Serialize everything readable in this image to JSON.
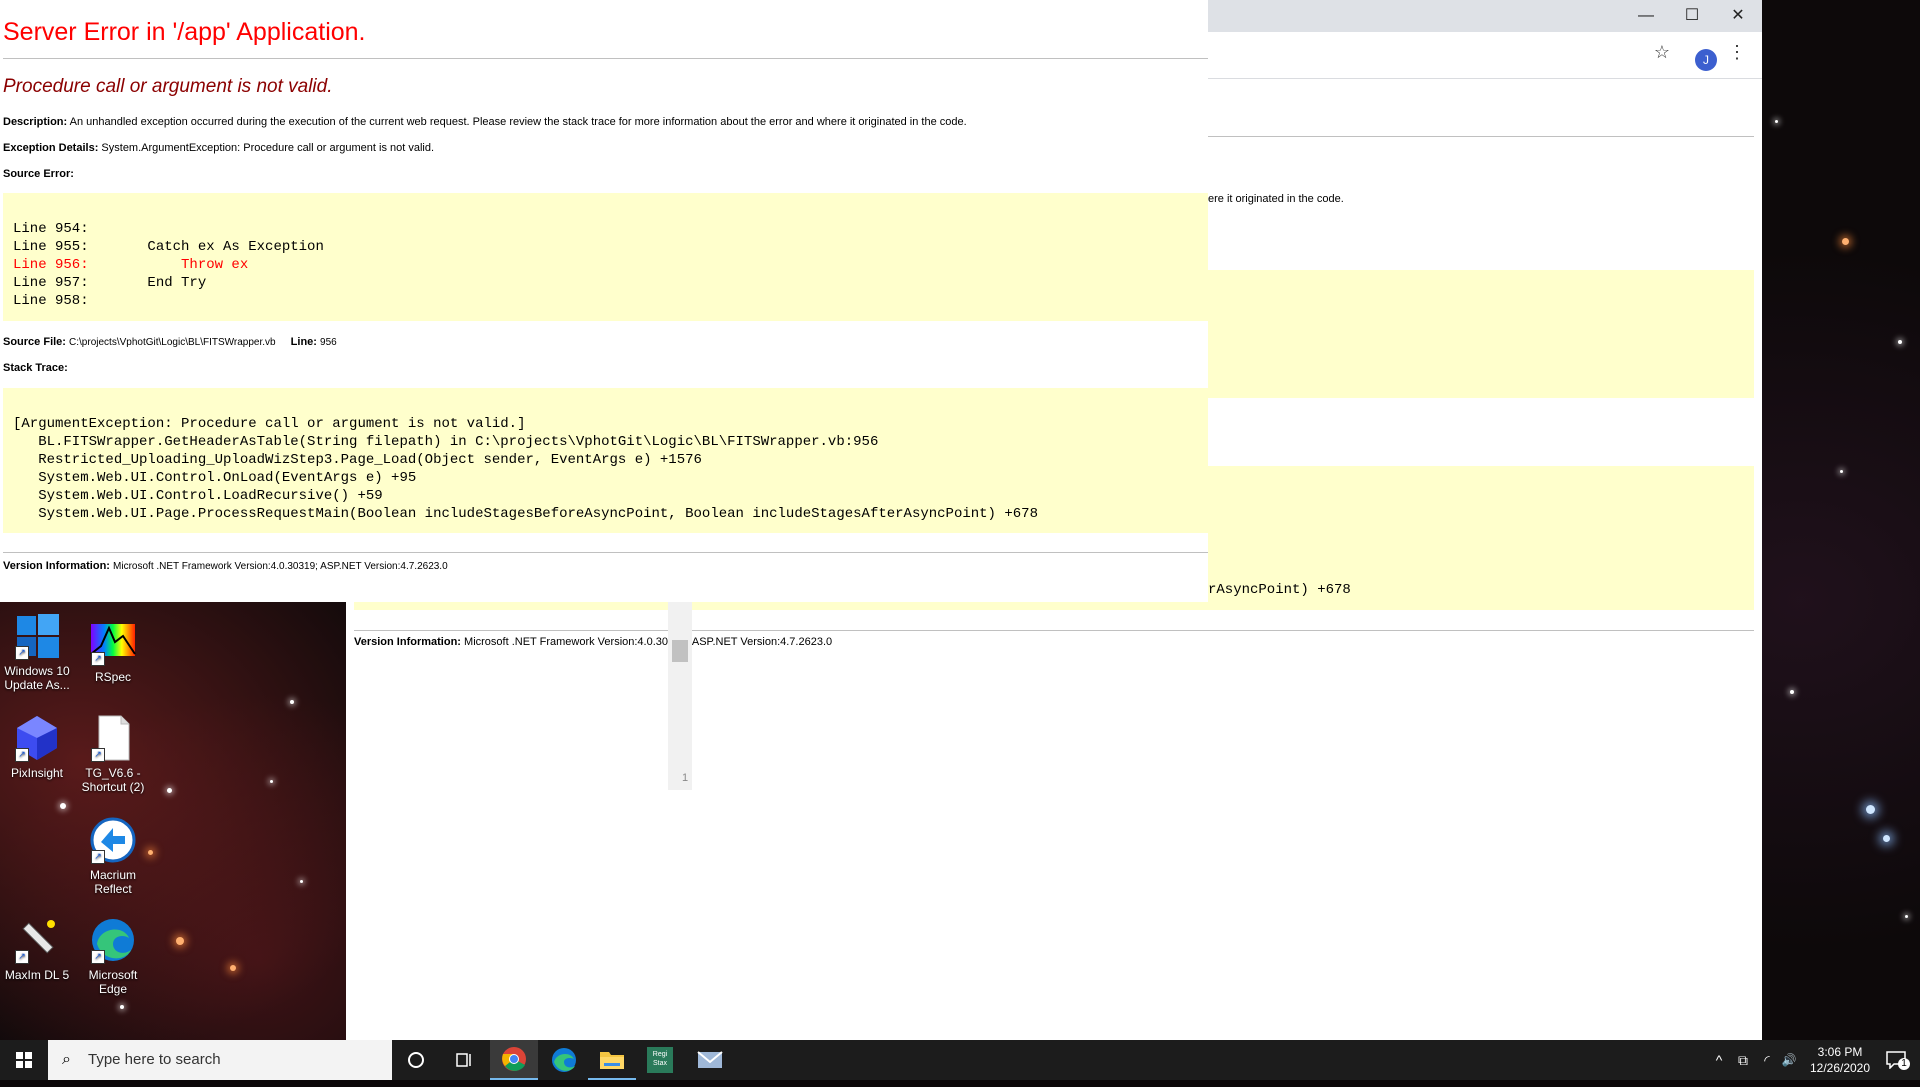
{
  "desktop": {
    "icons": [
      {
        "label": "Windows 10 Update As...",
        "icon": "windows-update-icon"
      },
      {
        "label": "RSpec",
        "icon": "rspec-icon"
      },
      {
        "label": "PixInsight",
        "icon": "pixinsight-icon"
      },
      {
        "label": "TG_V6.6 - Shortcut (2)",
        "icon": "file-icon"
      },
      {
        "label": "Macrium Reflect",
        "icon": "macrium-reflect-icon"
      },
      {
        "label": "MaxIm DL 5",
        "icon": "maxim-dl-icon"
      },
      {
        "label": "Microsoft Edge",
        "icon": "edge-icon"
      }
    ]
  },
  "browser": {
    "window_controls": {
      "minimize": "—",
      "maximize": "☐",
      "close": "✕"
    },
    "toolbar": {
      "star": "☆",
      "profile_initial": "J",
      "menu": "⋮"
    },
    "back_page": {
      "description_tail": "ere it originated in the code.",
      "stack_tail": "rAsyncPoint) +678",
      "version_label": "Version Information:",
      "version_value": "Microsoft .NET Framework Version:4.0.30319; ASP.NET Version:4.7.2623.0",
      "scroll_fragment": "1"
    }
  },
  "error_page": {
    "title": "Server Error in '/app' Application.",
    "subtitle": "Procedure call or argument is not valid.",
    "description_label": "Description:",
    "description": "An unhandled exception occurred during the execution of the current web request. Please review the stack trace for more information about the error and where it originated in the code.",
    "exception_label": "Exception Details:",
    "exception": "System.ArgumentException: Procedure call or argument is not valid.",
    "source_error_label": "Source Error:",
    "source_lines": [
      "Line 954:",
      "Line 955:       Catch ex As Exception",
      "Line 956:           Throw ex",
      "Line 957:       End Try",
      "Line 958:"
    ],
    "source_file_label": "Source File:",
    "source_file": "C:\\projects\\VphotGit\\Logic\\BL\\FITSWrapper.vb",
    "line_label": "Line:",
    "line_number": "956",
    "stack_trace_label": "Stack Trace:",
    "stack_lines": [
      "[ArgumentException: Procedure call or argument is not valid.]",
      "   BL.FITSWrapper.GetHeaderAsTable(String filepath) in C:\\projects\\VphotGit\\Logic\\BL\\FITSWrapper.vb:956",
      "   Restricted_Uploading_UploadWizStep3.Page_Load(Object sender, EventArgs e) +1576",
      "   System.Web.UI.Control.OnLoad(EventArgs e) +95",
      "   System.Web.UI.Control.LoadRecursive() +59",
      "   System.Web.UI.Page.ProcessRequestMain(Boolean includeStagesBeforeAsyncPoint, Boolean includeStagesAfterAsyncPoint) +678"
    ],
    "version_label": "Version Information:",
    "version": "Microsoft .NET Framework Version:4.0.30319; ASP.NET Version:4.7.2623.0"
  },
  "taskbar": {
    "search_placeholder": "Type here to search",
    "time": "3:06 PM",
    "date": "12/26/2020",
    "apps": [
      "cortana-icon",
      "task-view-icon",
      "chrome-icon",
      "edge-icon",
      "file-explorer-icon",
      "regi-stax-icon",
      "maxim-taskbar-icon"
    ],
    "regi_stax_label": "Regi Stax",
    "notification_count": "1",
    "tray": {
      "chevron": "^",
      "meet": "⧉",
      "network": "◜",
      "volume": "🔊"
    }
  }
}
